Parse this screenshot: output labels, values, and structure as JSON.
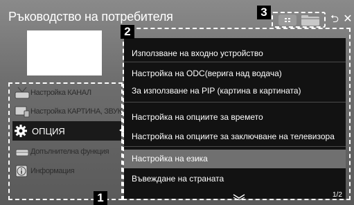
{
  "window": {
    "title": "Ръководство на потребителя"
  },
  "toolbar": {
    "grid_icon": "grid-icon",
    "folder_icon": "folder-icon",
    "back_glyph": "⮌",
    "close_glyph": "✕"
  },
  "badges": {
    "left": "1",
    "submenu": "2",
    "toolbar": "3"
  },
  "left_menu": {
    "items": [
      {
        "label": "Настройка КАНАЛ",
        "icon": "antenna-icon",
        "selected": false
      },
      {
        "label": "Настройка КАРТИНА, ЗВУК",
        "icon": "tv-speaker-icon",
        "selected": false
      },
      {
        "label": "ОПЦИЯ",
        "icon": "gear-icon",
        "selected": true
      },
      {
        "label": "Допълнителна функция",
        "icon": "extra-function-icon",
        "selected": false
      },
      {
        "label": "Информация",
        "icon": "info-icon",
        "selected": false
      }
    ]
  },
  "submenu": {
    "items": [
      {
        "label": "Използване на входно устройство"
      },
      {
        "label": "Настройка на ODC(верига над водача)"
      },
      {
        "label": "За използване на PIP (картина в картината)"
      },
      {
        "label": "Настройка на опциите за времето"
      },
      {
        "label": "Настройка на опциите за заключване на телевизора"
      },
      {
        "label": "Настройка на езика",
        "highlighted": true
      },
      {
        "label": "Въвеждане на страната"
      }
    ],
    "page_indicator": "1/2"
  },
  "colors": {
    "highlight": "#707070",
    "selected": "#1a1a1a",
    "submenu_bg": "#121212"
  }
}
